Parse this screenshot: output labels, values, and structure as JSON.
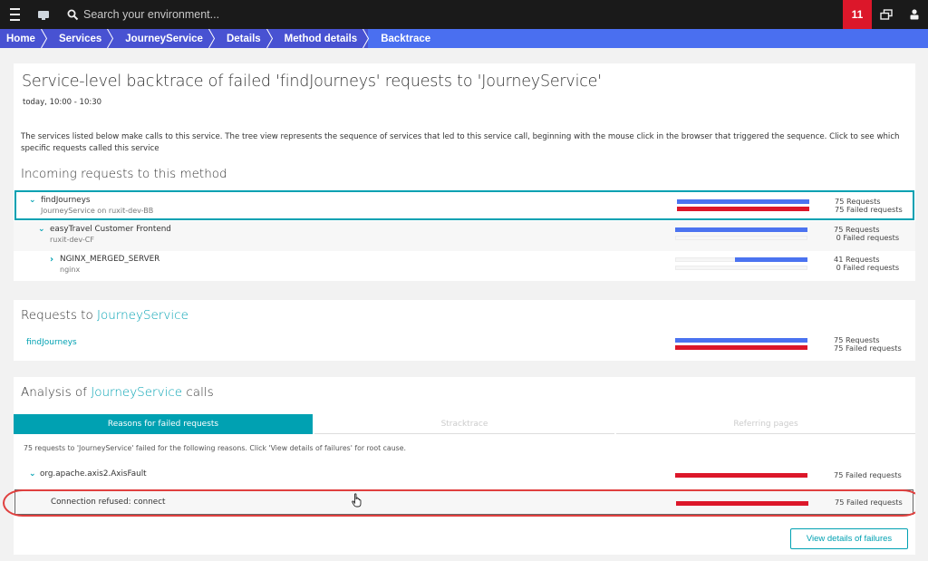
{
  "topbar": {
    "search_placeholder": "Search your environment...",
    "notification_count": "11",
    "icons": [
      "menu-icon",
      "monitor-icon",
      "search-icon",
      "windows-icon",
      "user-icon"
    ]
  },
  "breadcrumb": [
    "Home",
    "Services",
    "JourneyService",
    "Details",
    "Method details",
    "Backtrace"
  ],
  "colors": {
    "accent": "#00a1b2",
    "requests_bar": "#4b73f0",
    "failed_bar": "#dc172a",
    "breadcrumb": "#4852d2",
    "breadcrumb_current": "#4a6ff0",
    "badge": "#dc172a"
  },
  "backtrace": {
    "title": "Service-level backtrace of failed 'findJourneys' requests to 'JourneyService'",
    "time_range": "today, 10:00 - 10:30",
    "description": "The services listed below make calls to this service. The tree view represents the sequence of services that led to this service call, beginning with the mouse click in the browser that triggered the sequence. Click to see which specific requests called this service",
    "section_title": "Incoming requests to this method",
    "rows": [
      {
        "name": "findJourneys",
        "sub": "JourneyService on ruxit-dev-BB",
        "expanded": "true",
        "requests": 75,
        "failed": 75,
        "requests_label": "75 Requests",
        "failed_label": "75 Failed requests"
      },
      {
        "name": "easyTravel Customer Frontend",
        "sub": "ruxit-dev-CF",
        "expanded": "true",
        "requests": 75,
        "failed": 0,
        "requests_label": "75 Requests",
        "failed_label": " 0 Failed requests"
      },
      {
        "name": "NGINX_MERGED_SERVER",
        "sub": "nginx",
        "expanded": "false",
        "requests": 41,
        "failed": 0,
        "requests_label": "41 Requests",
        "failed_label": " 0 Failed requests"
      }
    ],
    "max_requests": 75
  },
  "requests_to": {
    "title_prefix": "Requests to ",
    "service": "JourneyService",
    "rows": [
      {
        "name": "findJourneys",
        "requests": 75,
        "failed": 75,
        "requests_label": "75 Requests",
        "failed_label": "75 Failed requests"
      }
    ]
  },
  "analysis": {
    "title_prefix": "Analysis of ",
    "service": "JourneyService",
    "title_suffix": " calls",
    "tabs": [
      {
        "label": "Reasons for failed requests",
        "active": true
      },
      {
        "label": "Stracktrace",
        "active": false
      },
      {
        "label": "Referring pages",
        "active": false
      }
    ],
    "reasons_description": "75 requests to 'JourneyService' failed for the following reasons. Click 'View details of failures' for root cause.",
    "reasons": [
      {
        "name": "org.apache.axis2.AxisFault",
        "failed": 75,
        "failed_label": "75 Failed requests",
        "expanded": "true"
      },
      {
        "name": "Connection refused: connect",
        "failed": 75,
        "failed_label": "75 Failed requests"
      }
    ],
    "view_details_button": "View details of failures"
  }
}
